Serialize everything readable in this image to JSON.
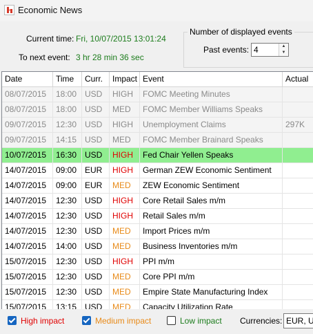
{
  "window": {
    "title": "Economic News"
  },
  "info": {
    "current_time_label": "Current time:",
    "current_time_value": "Fri, 10/07/2015  13:01:24",
    "next_event_label": "To next event:",
    "next_event_value": "3 hr 28 min 36 sec"
  },
  "display": {
    "group_title": "Number of displayed events",
    "past_label": "Past events:",
    "past_value": "4"
  },
  "table": {
    "headers": [
      "Date",
      "Time",
      "Curr.",
      "Impact",
      "Event",
      "Actual"
    ],
    "rows": [
      {
        "date": "08/07/2015",
        "time": "18:00",
        "curr": "USD",
        "impact": "HIGH",
        "event": "FOMC Meeting Minutes",
        "actual": "",
        "state": "past"
      },
      {
        "date": "08/07/2015",
        "time": "18:00",
        "curr": "USD",
        "impact": "MED",
        "event": "FOMC Member Williams Speaks",
        "actual": "",
        "state": "past"
      },
      {
        "date": "09/07/2015",
        "time": "12:30",
        "curr": "USD",
        "impact": "HIGH",
        "event": "Unemployment Claims",
        "actual": "297K",
        "state": "past"
      },
      {
        "date": "09/07/2015",
        "time": "14:15",
        "curr": "USD",
        "impact": "MED",
        "event": "FOMC Member Brainard Speaks",
        "actual": "",
        "state": "past"
      },
      {
        "date": "10/07/2015",
        "time": "16:30",
        "curr": "USD",
        "impact": "HIGH",
        "event": "Fed Chair Yellen Speaks",
        "actual": "",
        "state": "current"
      },
      {
        "date": "14/07/2015",
        "time": "09:00",
        "curr": "EUR",
        "impact": "HIGH",
        "event": "German ZEW Economic Sentiment",
        "actual": "",
        "state": "future"
      },
      {
        "date": "14/07/2015",
        "time": "09:00",
        "curr": "EUR",
        "impact": "MED",
        "event": "ZEW Economic Sentiment",
        "actual": "",
        "state": "future"
      },
      {
        "date": "14/07/2015",
        "time": "12:30",
        "curr": "USD",
        "impact": "HIGH",
        "event": "Core Retail Sales m/m",
        "actual": "",
        "state": "future"
      },
      {
        "date": "14/07/2015",
        "time": "12:30",
        "curr": "USD",
        "impact": "HIGH",
        "event": "Retail Sales m/m",
        "actual": "",
        "state": "future"
      },
      {
        "date": "14/07/2015",
        "time": "12:30",
        "curr": "USD",
        "impact": "MED",
        "event": "Import Prices m/m",
        "actual": "",
        "state": "future"
      },
      {
        "date": "14/07/2015",
        "time": "14:00",
        "curr": "USD",
        "impact": "MED",
        "event": "Business Inventories m/m",
        "actual": "",
        "state": "future"
      },
      {
        "date": "15/07/2015",
        "time": "12:30",
        "curr": "USD",
        "impact": "HIGH",
        "event": "PPI m/m",
        "actual": "",
        "state": "future"
      },
      {
        "date": "15/07/2015",
        "time": "12:30",
        "curr": "USD",
        "impact": "MED",
        "event": "Core PPI m/m",
        "actual": "",
        "state": "future"
      },
      {
        "date": "15/07/2015",
        "time": "12:30",
        "curr": "USD",
        "impact": "MED",
        "event": "Empire State Manufacturing Index",
        "actual": "",
        "state": "future"
      },
      {
        "date": "15/07/2015",
        "time": "13:15",
        "curr": "USD",
        "impact": "MED",
        "event": "Capacity Utilization Rate",
        "actual": "",
        "state": "future"
      }
    ]
  },
  "filters": {
    "high_label": "High impact",
    "med_label": "Medium impact",
    "low_label": "Low impact",
    "high_checked": true,
    "med_checked": true,
    "low_checked": false,
    "currencies_label": "Currencies:",
    "currencies_value": "EUR, USD"
  },
  "colors": {
    "current_row": "#90ee90",
    "high": "#e00000",
    "med": "#e88a18",
    "info_value": "#1c7c1c"
  }
}
